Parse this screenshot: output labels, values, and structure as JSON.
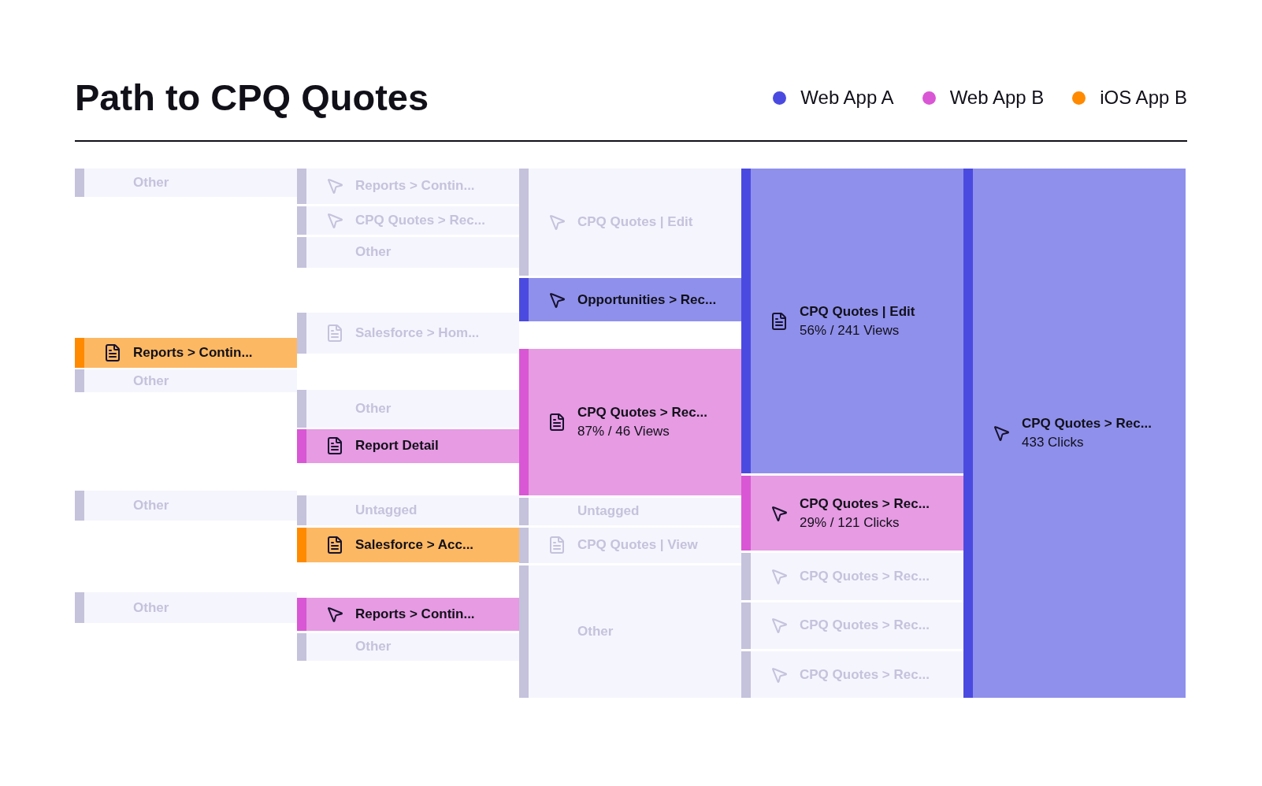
{
  "title": "Path to CPQ Quotes",
  "legend": [
    {
      "label": "Web App A",
      "color": "#4b4ae0"
    },
    {
      "label": "Web App B",
      "color": "#d957d4"
    },
    {
      "label": "iOS App B",
      "color": "#ff8a00"
    }
  ],
  "columns": [
    {
      "nodes": [
        {
          "label": "Other",
          "kind": "plain",
          "color": "#c5c2dc",
          "highlighted": false
        },
        {
          "label": "Reports > Contin...",
          "kind": "page",
          "color": "#ff8a00",
          "highlighted": true
        },
        {
          "label": "Other",
          "kind": "plain",
          "color": "#c5c2dc",
          "highlighted": false
        },
        {
          "label": "Other",
          "kind": "plain",
          "color": "#c5c2dc",
          "highlighted": false
        },
        {
          "label": "Other",
          "kind": "plain",
          "color": "#c5c2dc",
          "highlighted": false
        }
      ]
    },
    {
      "nodes": [
        {
          "label": "Reports > Contin...",
          "kind": "click",
          "color": "#c5c2dc",
          "highlighted": false
        },
        {
          "label": "CPQ Quotes > Rec...",
          "kind": "click",
          "color": "#c5c2dc",
          "highlighted": false
        },
        {
          "label": "Other",
          "kind": "plain",
          "color": "#c5c2dc",
          "highlighted": false
        },
        {
          "label": "Salesforce > Hom...",
          "kind": "page",
          "color": "#c5c2dc",
          "highlighted": false
        },
        {
          "label": "Other",
          "kind": "plain",
          "color": "#c5c2dc",
          "highlighted": false
        },
        {
          "label": "Report Detail",
          "kind": "page",
          "color": "#d957d4",
          "highlighted": true
        },
        {
          "label": "Untagged",
          "kind": "plain",
          "color": "#c5c2dc",
          "highlighted": false
        },
        {
          "label": "Salesforce > Acc...",
          "kind": "page",
          "color": "#ff8a00",
          "highlighted": true
        },
        {
          "label": "Reports > Contin...",
          "kind": "click",
          "color": "#d957d4",
          "highlighted": true
        },
        {
          "label": "Other",
          "kind": "plain",
          "color": "#c5c2dc",
          "highlighted": false
        }
      ]
    },
    {
      "nodes": [
        {
          "label": "CPQ Quotes | Edit",
          "kind": "click",
          "color": "#c5c2dc",
          "highlighted": false
        },
        {
          "label": "Opportunities > Rec...",
          "kind": "click",
          "color": "#4b4ae0",
          "highlighted": true
        },
        {
          "label": "CPQ Quotes > Rec...",
          "stats": "87% / 46 Views",
          "kind": "page",
          "color": "#d957d4",
          "highlighted": true
        },
        {
          "label": "Untagged",
          "kind": "plain",
          "color": "#c5c2dc",
          "highlighted": false
        },
        {
          "label": "CPQ Quotes | View",
          "kind": "page",
          "color": "#c5c2dc",
          "highlighted": false
        },
        {
          "label": "Other",
          "kind": "plain",
          "color": "#c5c2dc",
          "highlighted": false
        }
      ]
    },
    {
      "nodes": [
        {
          "label": "CPQ Quotes | Edit",
          "stats": "56% / 241 Views",
          "kind": "page",
          "color": "#4b4ae0",
          "highlighted": true
        },
        {
          "label": "CPQ Quotes > Rec...",
          "stats": "29% / 121 Clicks",
          "kind": "click",
          "color": "#d957d4",
          "highlighted": true
        },
        {
          "label": "CPQ Quotes > Rec...",
          "kind": "click",
          "color": "#c5c2dc",
          "highlighted": false
        },
        {
          "label": "CPQ Quotes > Rec...",
          "kind": "click",
          "color": "#c5c2dc",
          "highlighted": false
        },
        {
          "label": "CPQ Quotes > Rec...",
          "kind": "click",
          "color": "#c5c2dc",
          "highlighted": false
        }
      ]
    },
    {
      "nodes": [
        {
          "label": "CPQ Quotes > Rec...",
          "stats": "433 Clicks",
          "kind": "click",
          "color": "#4b4ae0",
          "highlighted": true
        }
      ]
    }
  ]
}
